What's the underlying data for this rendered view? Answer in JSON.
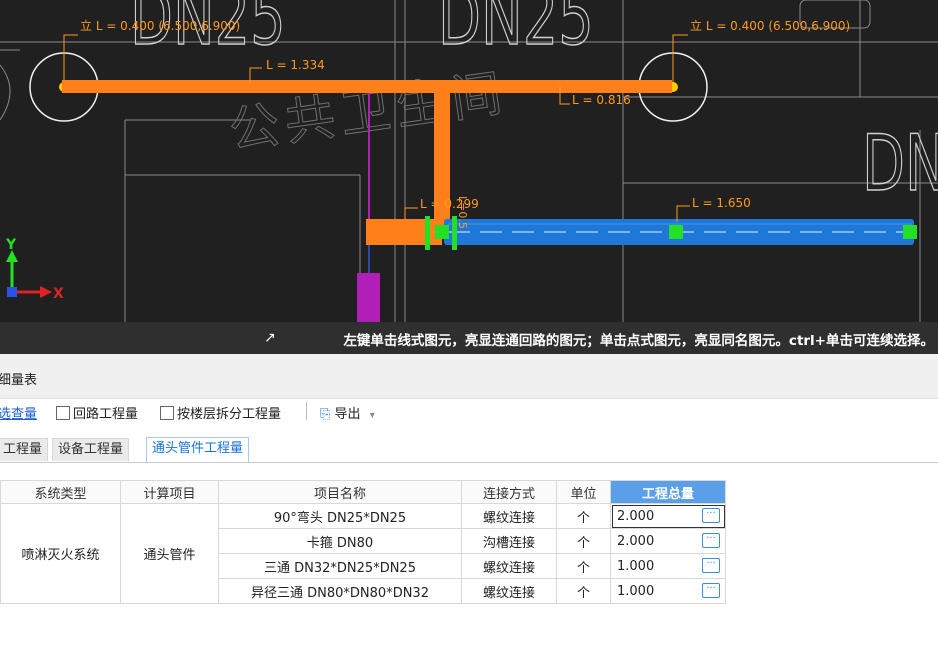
{
  "cad": {
    "labels": {
      "vertical_left": "立 L = 0.400 (6.500,6.900)",
      "vertical_right": "立 L = 0.400 (6.500,6.900)",
      "seg_top": "L = 1.334",
      "seg_mid": "L = 0.816",
      "seg_small": "L = 0.299",
      "seg_vertical": "L=0.5",
      "seg_blue": "L = 1.650",
      "big_text_1": "DN25",
      "big_text_2": "DN25",
      "big_text_right": "DN",
      "watermark": "公共卫生间",
      "axis_x": "X",
      "axis_y": "Y"
    },
    "colors": {
      "background": "#202020",
      "pipe_orange": "#ff7f1a",
      "pipe_blue": "#1f78d8",
      "marker_green": "#22e022",
      "label_orange": "#ff9a1f",
      "riser_magenta": "#b21fb8"
    },
    "status_icon": "cursor-link-icon",
    "status_text": "左键单击线式图元，亮显连通回路的图元；单击点式图元，亮显同名图元。ctrl+单击可连续选择。"
  },
  "panel": {
    "title": "细量表",
    "toolbar": {
      "link_label": "选查量",
      "loop_qty_label": "回路工程量",
      "by_floor_label": "按楼层拆分工程量",
      "export_label": "导出",
      "export_icon": "export-icon",
      "dropdown_icon": "caret-down-icon"
    },
    "tabs": [
      {
        "label": "工程量",
        "active": false
      },
      {
        "label": "设备工程量",
        "active": false
      },
      {
        "label": "通头管件工程量",
        "active": true
      }
    ],
    "table": {
      "headers": [
        "系统类型",
        "计算项目",
        "项目名称",
        "连接方式",
        "单位",
        "工程总量"
      ],
      "system_type": "喷淋灭火系统",
      "calc_item": "通头管件",
      "rows": [
        {
          "name": "90°弯头 DN25*DN25",
          "connection": "螺纹连接",
          "unit": "个",
          "total": "2.000"
        },
        {
          "name": "卡箍 DN80",
          "connection": "沟槽连接",
          "unit": "个",
          "total": "2.000"
        },
        {
          "name": "三通 DN32*DN25*DN25",
          "connection": "螺纹连接",
          "unit": "个",
          "total": "1.000"
        },
        {
          "name": "异径三通 DN80*DN80*DN32",
          "connection": "螺纹连接",
          "unit": "个",
          "total": "1.000"
        }
      ],
      "more_button_label": "···"
    }
  }
}
